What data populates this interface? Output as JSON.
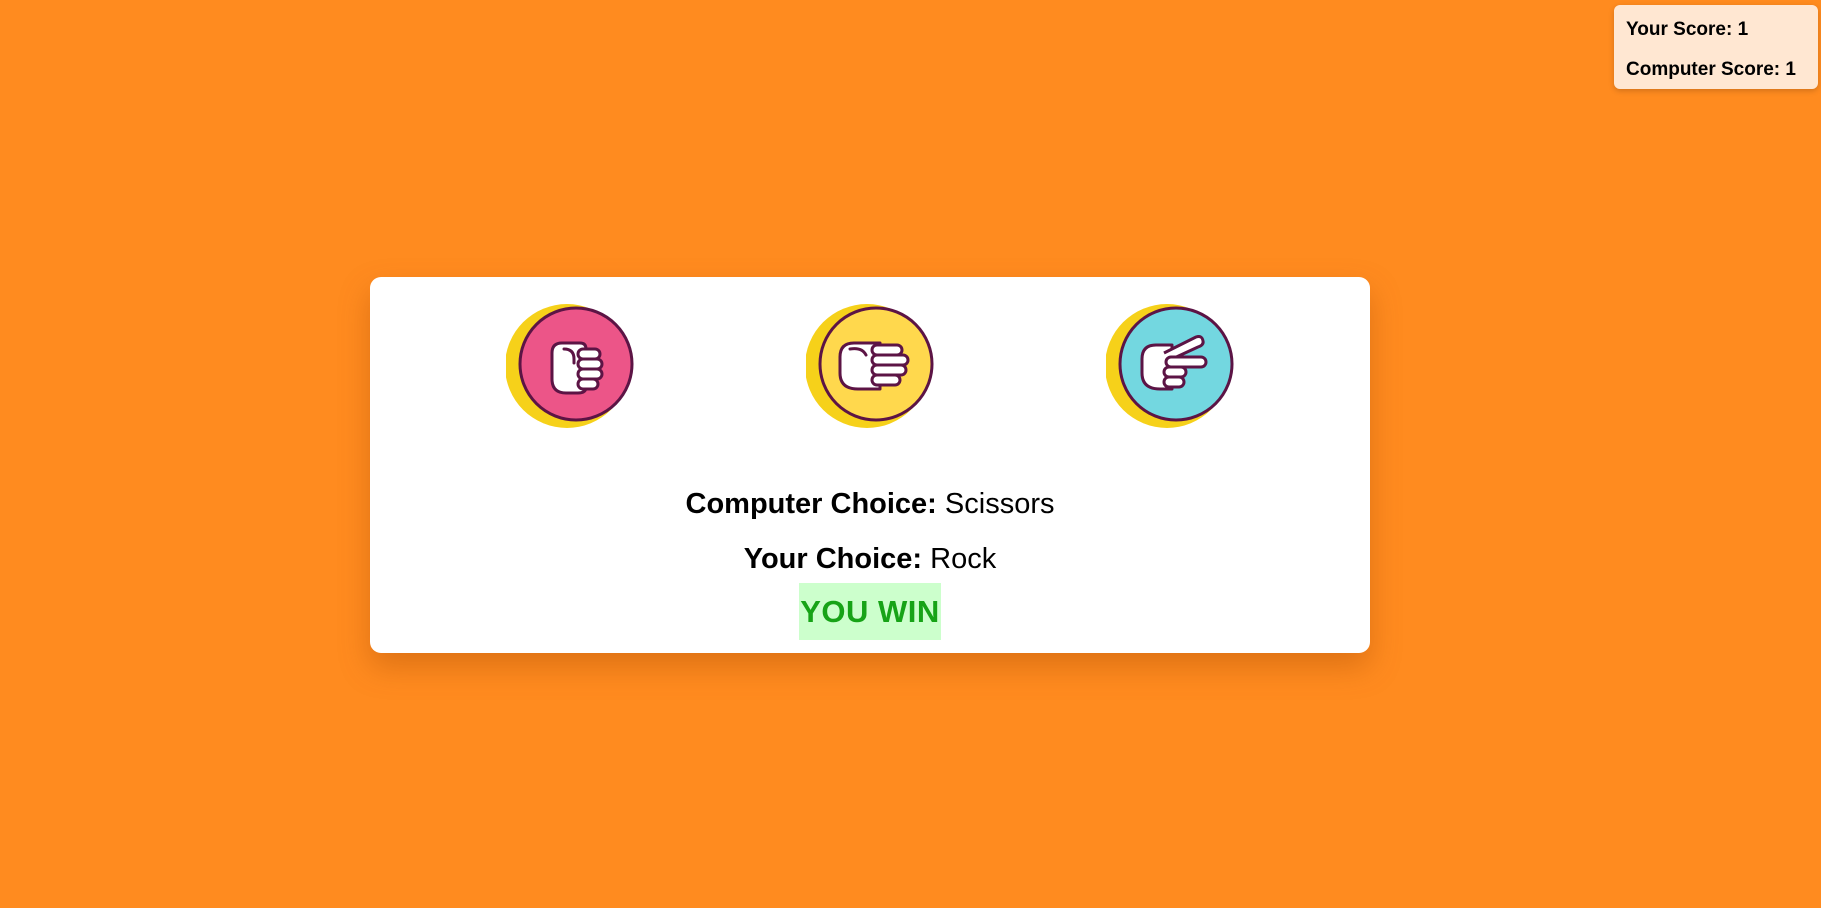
{
  "scoreboard": {
    "your_score_label": "Your Score:",
    "your_score_value": "1",
    "computer_score_label": "Computer Score:",
    "computer_score_value": "1"
  },
  "choices": [
    {
      "name": "Rock",
      "icon": "rock-fist-icon",
      "color": "#ec5588"
    },
    {
      "name": "Paper",
      "icon": "paper-hand-icon",
      "color": "#ffd84d"
    },
    {
      "name": "Scissors",
      "icon": "scissors-hand-icon",
      "color": "#73d7e0"
    }
  ],
  "result": {
    "computer_choice_label": "Computer Choice:",
    "computer_choice_value": "Scissors",
    "your_choice_label": "Your Choice:",
    "your_choice_value": "Rock",
    "outcome": "YOU WIN"
  },
  "colors": {
    "background": "#ff8b1f",
    "ring_shadow": "#f6d11a",
    "outline": "#5c1445",
    "win_text": "#17a317",
    "win_bg": "#ccffcc"
  }
}
